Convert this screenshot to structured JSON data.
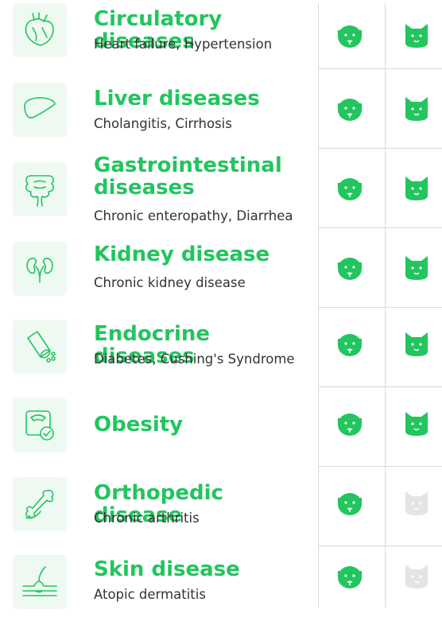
{
  "colors": {
    "accent": "#22c55e",
    "inactive": "#e4e4e4",
    "icon_bg": "#eef9f2",
    "divider": "#d9d9d9"
  },
  "diseases": [
    {
      "title": "Circulatory diseases",
      "subtitle": "Heart failure, Hypertension",
      "icon": "heart-icon",
      "dog": true,
      "cat": true
    },
    {
      "title": "Liver diseases",
      "subtitle": "Cholangitis, Cirrhosis",
      "icon": "liver-icon",
      "dog": true,
      "cat": true
    },
    {
      "title": "Gastrointestinal diseases",
      "subtitle": "Chronic enteropathy, Diarrhea",
      "icon": "intestine-icon",
      "dog": true,
      "cat": true
    },
    {
      "title": "Kidney disease",
      "subtitle": "Chronic kidney disease",
      "icon": "kidney-icon",
      "dog": true,
      "cat": true
    },
    {
      "title": "Endocrine diseases",
      "subtitle": "Diabetes, Cushing's Syndrome",
      "icon": "pill-bottle-icon",
      "dog": true,
      "cat": true
    },
    {
      "title": "Obesity",
      "subtitle": "",
      "icon": "scale-icon",
      "dog": true,
      "cat": true
    },
    {
      "title": "Orthopedic disease",
      "subtitle": "Chronic arthritis",
      "icon": "bone-icon",
      "dog": true,
      "cat": false
    },
    {
      "title": "Skin disease",
      "subtitle": "Atopic dermatitis",
      "icon": "skin-icon",
      "dog": true,
      "cat": false
    }
  ]
}
